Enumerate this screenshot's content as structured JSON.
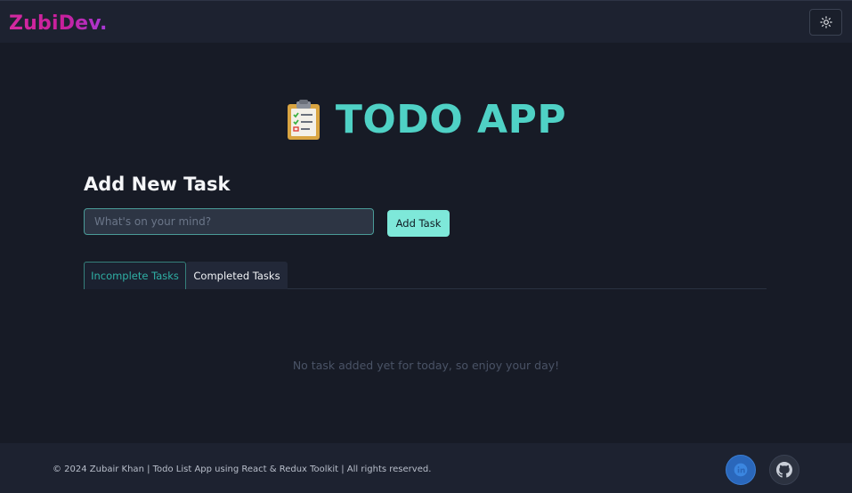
{
  "navbar": {
    "brand": "ZubiDev.",
    "theme_toggle_icon": "sun-icon"
  },
  "hero": {
    "icon": "clipboard-checklist-icon",
    "title": "TODO APP"
  },
  "add_task": {
    "heading": "Add New Task",
    "input_placeholder": "What's on your mind?",
    "input_value": "",
    "button_label": "Add Task"
  },
  "tabs": [
    {
      "label": "Incomplete Tasks",
      "active": true
    },
    {
      "label": "Completed Tasks",
      "active": false
    }
  ],
  "empty_state": "No task added yet for today, so enjoy your day!",
  "footer": {
    "copyright": "© 2024 Zubair Khan | Todo List App using React & Redux Toolkit | All rights reserved.",
    "social": [
      {
        "icon": "linkedin-icon"
      },
      {
        "icon": "github-icon"
      }
    ]
  },
  "colors": {
    "background": "#171b26",
    "bar": "#1d2230",
    "accent": "#4fd1c5",
    "button": "#7ee8d9",
    "brand_pink": "#c81f9c"
  }
}
